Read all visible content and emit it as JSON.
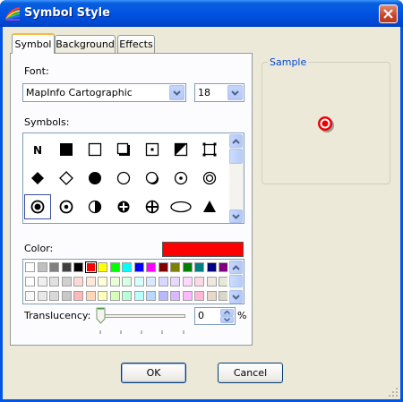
{
  "window": {
    "title": "Symbol Style",
    "icons": {
      "app": "mapinfo-app-icon",
      "close": "close-icon"
    }
  },
  "tabs": [
    {
      "label": "Symbol",
      "active": true
    },
    {
      "label": "Background",
      "active": false
    },
    {
      "label": "Effects",
      "active": false
    }
  ],
  "font": {
    "label": "Font:",
    "value": "MapInfo Cartographic",
    "size_value": "18"
  },
  "symbols": {
    "label": "Symbols:",
    "rows": [
      [
        "letter-n",
        "filled-square",
        "hollow-square",
        "shadowed-square",
        "dotted-square",
        "half-filled-square",
        "corner-square"
      ],
      [
        "filled-diamond",
        "hollow-diamond",
        "filled-circle",
        "hollow-circle",
        "shadowed-circle",
        "dotted-circle",
        "double-circle"
      ],
      [
        "target-circle",
        "dotted-circle-bold",
        "half-filled-circle",
        "cross-circle",
        "plus-circle",
        "ellipse",
        "filled-triangle"
      ]
    ],
    "selected_index": [
      2,
      0
    ]
  },
  "color": {
    "label": "Color:",
    "current": "#ff0000",
    "palette_row1": [
      "#ffffff",
      "#c0c0c0",
      "#808080",
      "#404040",
      "#000000",
      "#ff0000",
      "#ffff00",
      "#00ff00",
      "#00ffff",
      "#0000ff",
      "#ff00ff",
      "#800000",
      "#808000",
      "#008000",
      "#008080",
      "#000080",
      "#800080"
    ],
    "palette_row2": [
      "#ffffff",
      "#f0f0f0",
      "#e0e0e0",
      "#d0d0d0",
      "#ffd8d8",
      "#ffe8d8",
      "#ffffd8",
      "#e8ffd8",
      "#d8ffe8",
      "#d8ffff",
      "#d8e8ff",
      "#d8d8ff",
      "#e8d8ff",
      "#ffd8ff",
      "#ffd8e8",
      "#f0e8e0",
      "#e8e8d8"
    ],
    "palette_row3": [
      "#f8f8f8",
      "#e8e8e8",
      "#d8d8d8",
      "#c8c8c8",
      "#ffb8b8",
      "#ffd8b8",
      "#ffffb8",
      "#d8ffb8",
      "#b8ffd8",
      "#b8ffff",
      "#b8d8ff",
      "#b8b8ff",
      "#d8b8ff",
      "#ffb8ff",
      "#ffb8d8",
      "#e8d8c8",
      "#d8d8c8"
    ],
    "selected_index": 5
  },
  "translucency": {
    "label": "Translucency:",
    "value": "0",
    "unit": "%",
    "level": 0
  },
  "sample": {
    "label": "Sample"
  },
  "buttons": {
    "ok": "OK",
    "cancel": "Cancel"
  }
}
